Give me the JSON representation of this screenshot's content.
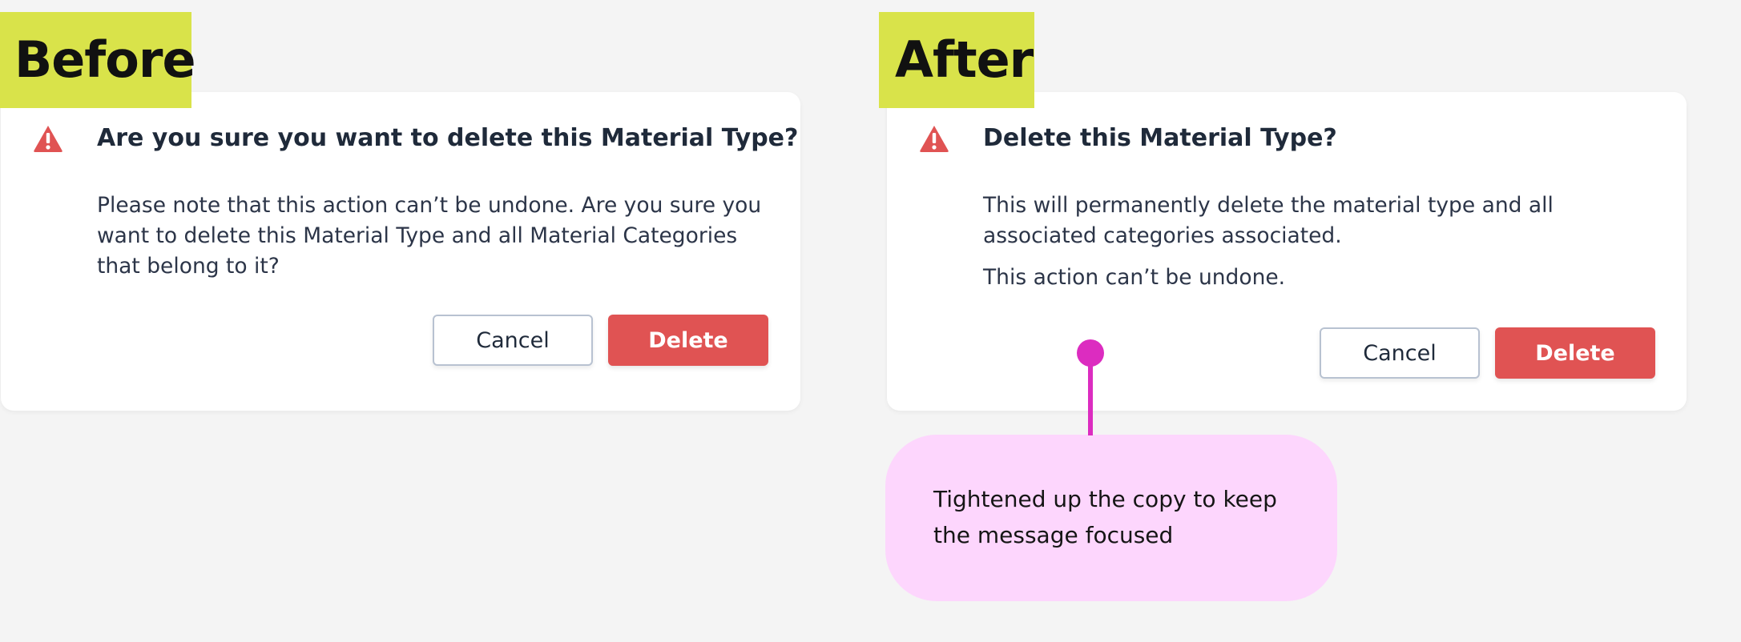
{
  "before": {
    "tag": "Before",
    "title": "Are you sure you want to delete this Material Type?",
    "body": "Please note that this action can’t be undone. Are you sure you want to delete this Material Type and all Material Categories that belong to it?",
    "cancel_label": "Cancel",
    "delete_label": "Delete",
    "icon": "warning-triangle-icon"
  },
  "after": {
    "tag": "After",
    "title": "Delete this Material Type?",
    "body_1": "This will permanently delete the material type and all associated categories associated.",
    "body_2": "This action can’t be undone.",
    "cancel_label": "Cancel",
    "delete_label": "Delete",
    "icon": "warning-triangle-icon"
  },
  "annotation": {
    "text": "Tightened up the copy to keep the message focused"
  },
  "colors": {
    "tag_bg": "#d9e34a",
    "delete_button": "#e05353",
    "warning_icon": "#e05353",
    "annotation_accent": "#dc2cc0",
    "annotation_bg": "#fdd6fd",
    "page_bg": "#f4f4f4"
  }
}
